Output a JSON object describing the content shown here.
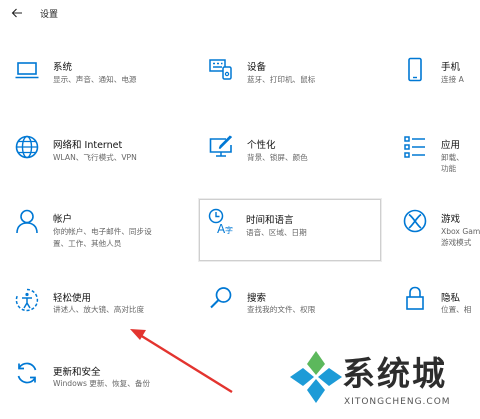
{
  "window": {
    "back_icon": "back-arrow-icon",
    "title": "设置"
  },
  "accent_color": "#0078d4",
  "tiles": [
    {
      "key": "system",
      "icon": "laptop-icon",
      "name": "系统",
      "desc": [
        "显示、声音、通知、电源"
      ]
    },
    {
      "key": "devices",
      "icon": "keyboard-icon",
      "name": "设备",
      "desc": [
        "蓝牙、打印机、鼠标"
      ]
    },
    {
      "key": "phone",
      "icon": "phone-icon",
      "name": "手机",
      "desc": [
        "连接 A"
      ]
    },
    {
      "key": "network",
      "icon": "globe-icon",
      "name": "网络和 Internet",
      "desc": [
        "WLAN、飞行模式、VPN"
      ]
    },
    {
      "key": "personalization",
      "icon": "pen-monitor-icon",
      "name": "个性化",
      "desc": [
        "背景、锁屏、颜色"
      ]
    },
    {
      "key": "apps",
      "icon": "apps-list-icon",
      "name": "应用",
      "desc": [
        "卸载、",
        "功能"
      ]
    },
    {
      "key": "accounts",
      "icon": "person-icon",
      "name": "帐户",
      "desc": [
        "你的帐户、电子邮件、同步设",
        "置、工作、其他人员"
      ]
    },
    {
      "key": "time_language",
      "icon": "time-language-icon",
      "name": "时间和语言",
      "desc": [
        "语音、区域、日期"
      ]
    },
    {
      "key": "gaming",
      "icon": "xbox-icon",
      "name": "游戏",
      "desc": [
        "Xbox Game",
        "游戏模式"
      ]
    },
    {
      "key": "ease_of_access",
      "icon": "ease-of-access-icon",
      "name": "轻松使用",
      "desc": [
        "讲述人、放大镜、高对比度"
      ]
    },
    {
      "key": "search",
      "icon": "search-icon",
      "name": "搜索",
      "desc": [
        "查找我的文件、权限"
      ]
    },
    {
      "key": "privacy",
      "icon": "lock-icon",
      "name": "隐私",
      "desc": [
        "位置、相"
      ]
    },
    {
      "key": "update_security",
      "icon": "sync-icon",
      "name": "更新和安全",
      "desc": [
        "Windows 更新、恢复、备份"
      ]
    }
  ],
  "watermark": {
    "text": "系统城",
    "url_text": "XITONGCHENG.COM"
  }
}
